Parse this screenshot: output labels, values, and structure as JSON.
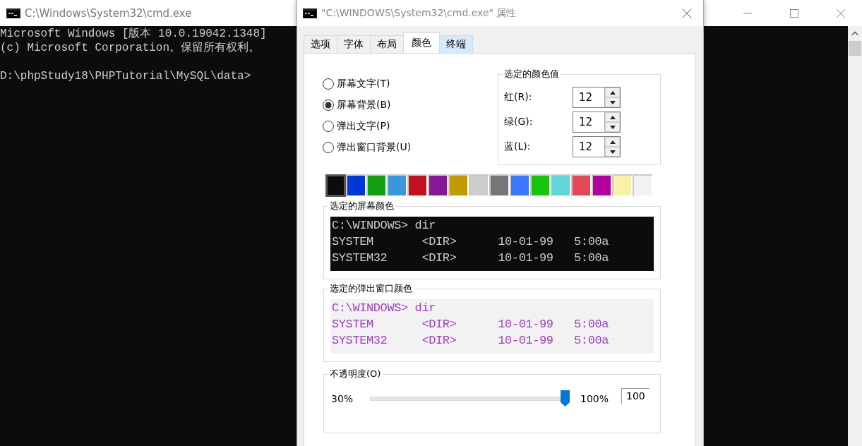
{
  "console": {
    "title": "C:\\Windows\\System32\\cmd.exe",
    "paragraphs": [
      {
        "lines": [
          "Microsoft Windows [版本 10.0.19042.1348]",
          "(c) Microsoft Corporation。保留所有权利。"
        ]
      },
      {
        "lines": [
          "D:\\phpStudy18\\PHPTutorial\\MySQL\\data>"
        ]
      }
    ]
  },
  "dialog": {
    "title": "\"C:\\WINDOWS\\System32\\cmd.exe\" 属性",
    "tabs": [
      {
        "label": "选项",
        "selected": false,
        "hovered": false
      },
      {
        "label": "字体",
        "selected": false,
        "hovered": false
      },
      {
        "label": "布局",
        "selected": false,
        "hovered": false
      },
      {
        "label": "颜色",
        "selected": true,
        "hovered": false
      },
      {
        "label": "终端",
        "selected": false,
        "hovered": true
      }
    ],
    "radios": [
      {
        "label": "屏幕文字(T)",
        "selected": false
      },
      {
        "label": "屏幕背景(B)",
        "selected": true
      },
      {
        "label": "弹出文字(P)",
        "selected": false
      },
      {
        "label": "弹出窗口背景(U)",
        "selected": false
      }
    ],
    "color_values": {
      "legend": "选定的颜色值",
      "fields": [
        {
          "label": "红(R):",
          "value": "12"
        },
        {
          "label": "绿(G):",
          "value": "12"
        },
        {
          "label": "蓝(L):",
          "value": "12"
        }
      ]
    },
    "swatches": [
      {
        "color": "#0c0c0c",
        "selected": true
      },
      {
        "color": "#0037da",
        "selected": false
      },
      {
        "color": "#13a10e",
        "selected": false
      },
      {
        "color": "#3a96dd",
        "selected": false
      },
      {
        "color": "#c50f1f",
        "selected": false
      },
      {
        "color": "#881798",
        "selected": false
      },
      {
        "color": "#c19c00",
        "selected": false
      },
      {
        "color": "#cccccc",
        "selected": false
      },
      {
        "color": "#767676",
        "selected": false
      },
      {
        "color": "#3b78ff",
        "selected": false
      },
      {
        "color": "#16c60c",
        "selected": false
      },
      {
        "color": "#61d6d6",
        "selected": false
      },
      {
        "color": "#e74856",
        "selected": false
      },
      {
        "color": "#b4009e",
        "selected": false
      },
      {
        "color": "#f9f1a5",
        "selected": false
      },
      {
        "color": "#f2f2f2",
        "selected": false
      }
    ],
    "screen_preview": {
      "legend": "选定的屏幕颜色",
      "lines": [
        "C:\\WINDOWS> dir",
        "SYSTEM       <DIR>      10-01-99   5:00a",
        "SYSTEM32     <DIR>      10-01-99   5:00a"
      ]
    },
    "popup_preview": {
      "legend": "选定的弹出窗口颜色",
      "lines": [
        "C:\\WINDOWS> dir",
        "SYSTEM       <DIR>      10-01-99   5:00a",
        "SYSTEM32     <DIR>      10-01-99   5:00a"
      ]
    },
    "opacity": {
      "legend": "不透明度(O)",
      "min_label": "30%",
      "max_label": "100%",
      "level": 1,
      "value": "100"
    }
  }
}
